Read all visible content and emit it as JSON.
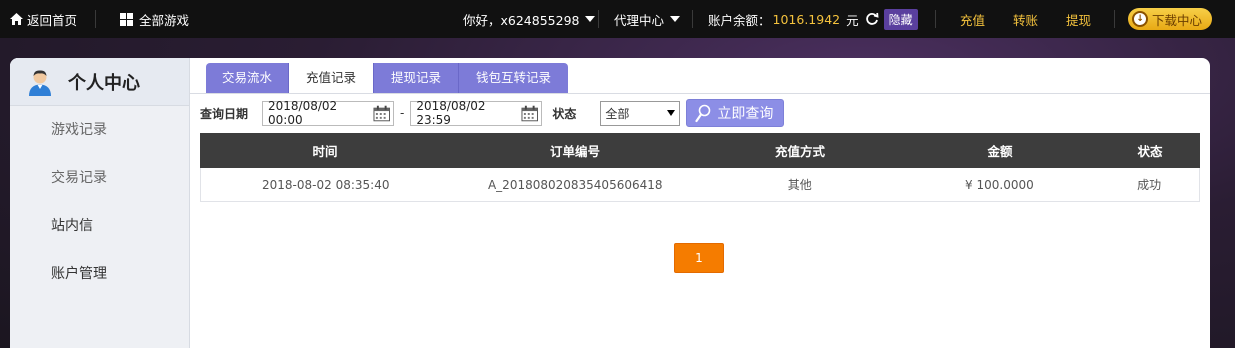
{
  "topbar": {
    "home_label": "返回首页",
    "all_games_label": "全部游戏",
    "greeting": "你好，x624855298",
    "agent_center": "代理中心",
    "balance_label": "账户余额：",
    "balance_value": "1016.1942",
    "balance_unit": "元",
    "hide_label": "隐藏",
    "recharge": "充值",
    "transfer": "转账",
    "withdraw": "提现",
    "download": "下载中心"
  },
  "sidebar": {
    "title": "个人中心",
    "items": [
      {
        "label": "游戏记录"
      },
      {
        "label": "交易记录"
      },
      {
        "label": "站内信"
      },
      {
        "label": "账户管理"
      }
    ]
  },
  "tabs": [
    {
      "label": "交易流水"
    },
    {
      "label": "充值记录"
    },
    {
      "label": "提现记录"
    },
    {
      "label": "钱包互转记录"
    }
  ],
  "filter": {
    "date_label": "查询日期",
    "start_date": "2018/08/02 00:00",
    "end_date": "2018/08/02 23:59",
    "separator": "-",
    "status_label": "状态",
    "status_value": "全部",
    "search_label": "立即查询"
  },
  "table": {
    "headers": [
      "时间",
      "订单编号",
      "充值方式",
      "金额",
      "状态"
    ],
    "rows": [
      [
        "2018-08-02 08:35:40",
        "A_20180802083540560641​8",
        "其他",
        "¥ 100.0000",
        "成功"
      ]
    ]
  },
  "pagination": {
    "current": "1"
  },
  "colors": {
    "accent": "#7d7bd8",
    "gold": "#f4c23d",
    "pager": "#f57c00",
    "table_header": "#3d3d3d"
  }
}
